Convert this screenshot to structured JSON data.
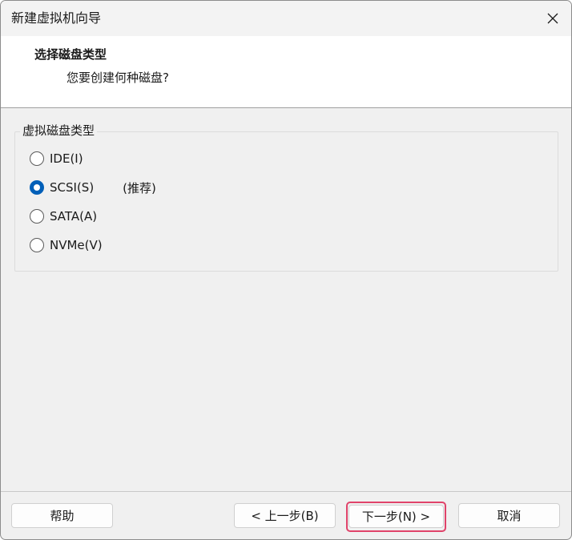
{
  "window": {
    "title": "新建虚拟机向导"
  },
  "icons": {
    "close": "close-icon"
  },
  "header": {
    "title": "选择磁盘类型",
    "subtitle": "您要创建何种磁盘?"
  },
  "disk_type_group": {
    "label": "虚拟磁盘类型",
    "options": [
      {
        "label": "IDE(I)",
        "checked": false,
        "note": ""
      },
      {
        "label": "SCSI(S)",
        "checked": true,
        "note": "(推荐)"
      },
      {
        "label": "SATA(A)",
        "checked": false,
        "note": ""
      },
      {
        "label": "NVMe(V)",
        "checked": false,
        "note": ""
      }
    ]
  },
  "buttons": {
    "help": "帮助",
    "back": "< 上一步(B)",
    "next": "下一步(N) >",
    "cancel": "取消"
  },
  "colors": {
    "accent": "#005fb8",
    "focus_highlight": "#e0436a",
    "window_bg": "#f0f0f0",
    "header_bg": "#ffffff"
  }
}
